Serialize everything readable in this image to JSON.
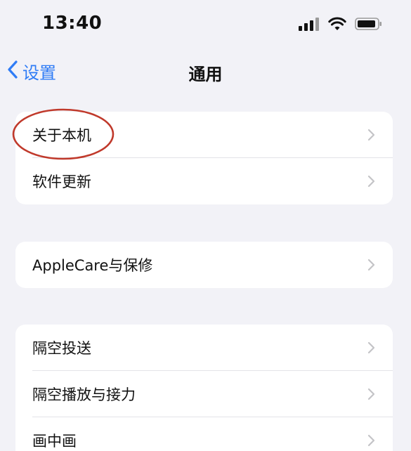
{
  "status": {
    "time": "13:40"
  },
  "nav": {
    "back_label": "设置",
    "title": "通用"
  },
  "groups": [
    {
      "items": [
        {
          "label": "关于本机"
        },
        {
          "label": "软件更新"
        }
      ]
    },
    {
      "items": [
        {
          "label": "AppleCare与保修"
        }
      ]
    },
    {
      "items": [
        {
          "label": "隔空投送"
        },
        {
          "label": "隔空播放与接力"
        },
        {
          "label": "画中画"
        }
      ]
    }
  ],
  "colors": {
    "accent": "#2f7cf6",
    "annotation": "#c0392b"
  },
  "icons": {
    "signal": "cellular-signal-icon",
    "wifi": "wifi-icon",
    "battery": "battery-icon",
    "back": "chevron-left-icon",
    "row": "chevron-right-icon"
  }
}
